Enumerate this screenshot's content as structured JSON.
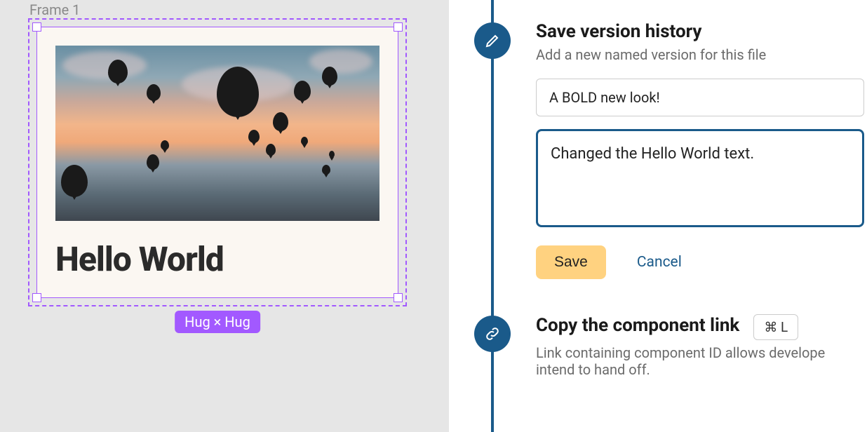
{
  "canvas": {
    "frame_label": "Frame 1",
    "card_text": "Hello World",
    "size_label": "Hug × Hug"
  },
  "timeline": {
    "save_version": {
      "title": "Save version history",
      "subtitle": "Add a new named version for this file",
      "name_value": "A BOLD new look!",
      "description_value": "Changed the Hello World text.",
      "save_label": "Save",
      "cancel_label": "Cancel"
    },
    "copy_link": {
      "title": "Copy the component link",
      "shortcut": "⌘ L",
      "description": "Link containing component ID allows develope intend to hand off."
    }
  }
}
